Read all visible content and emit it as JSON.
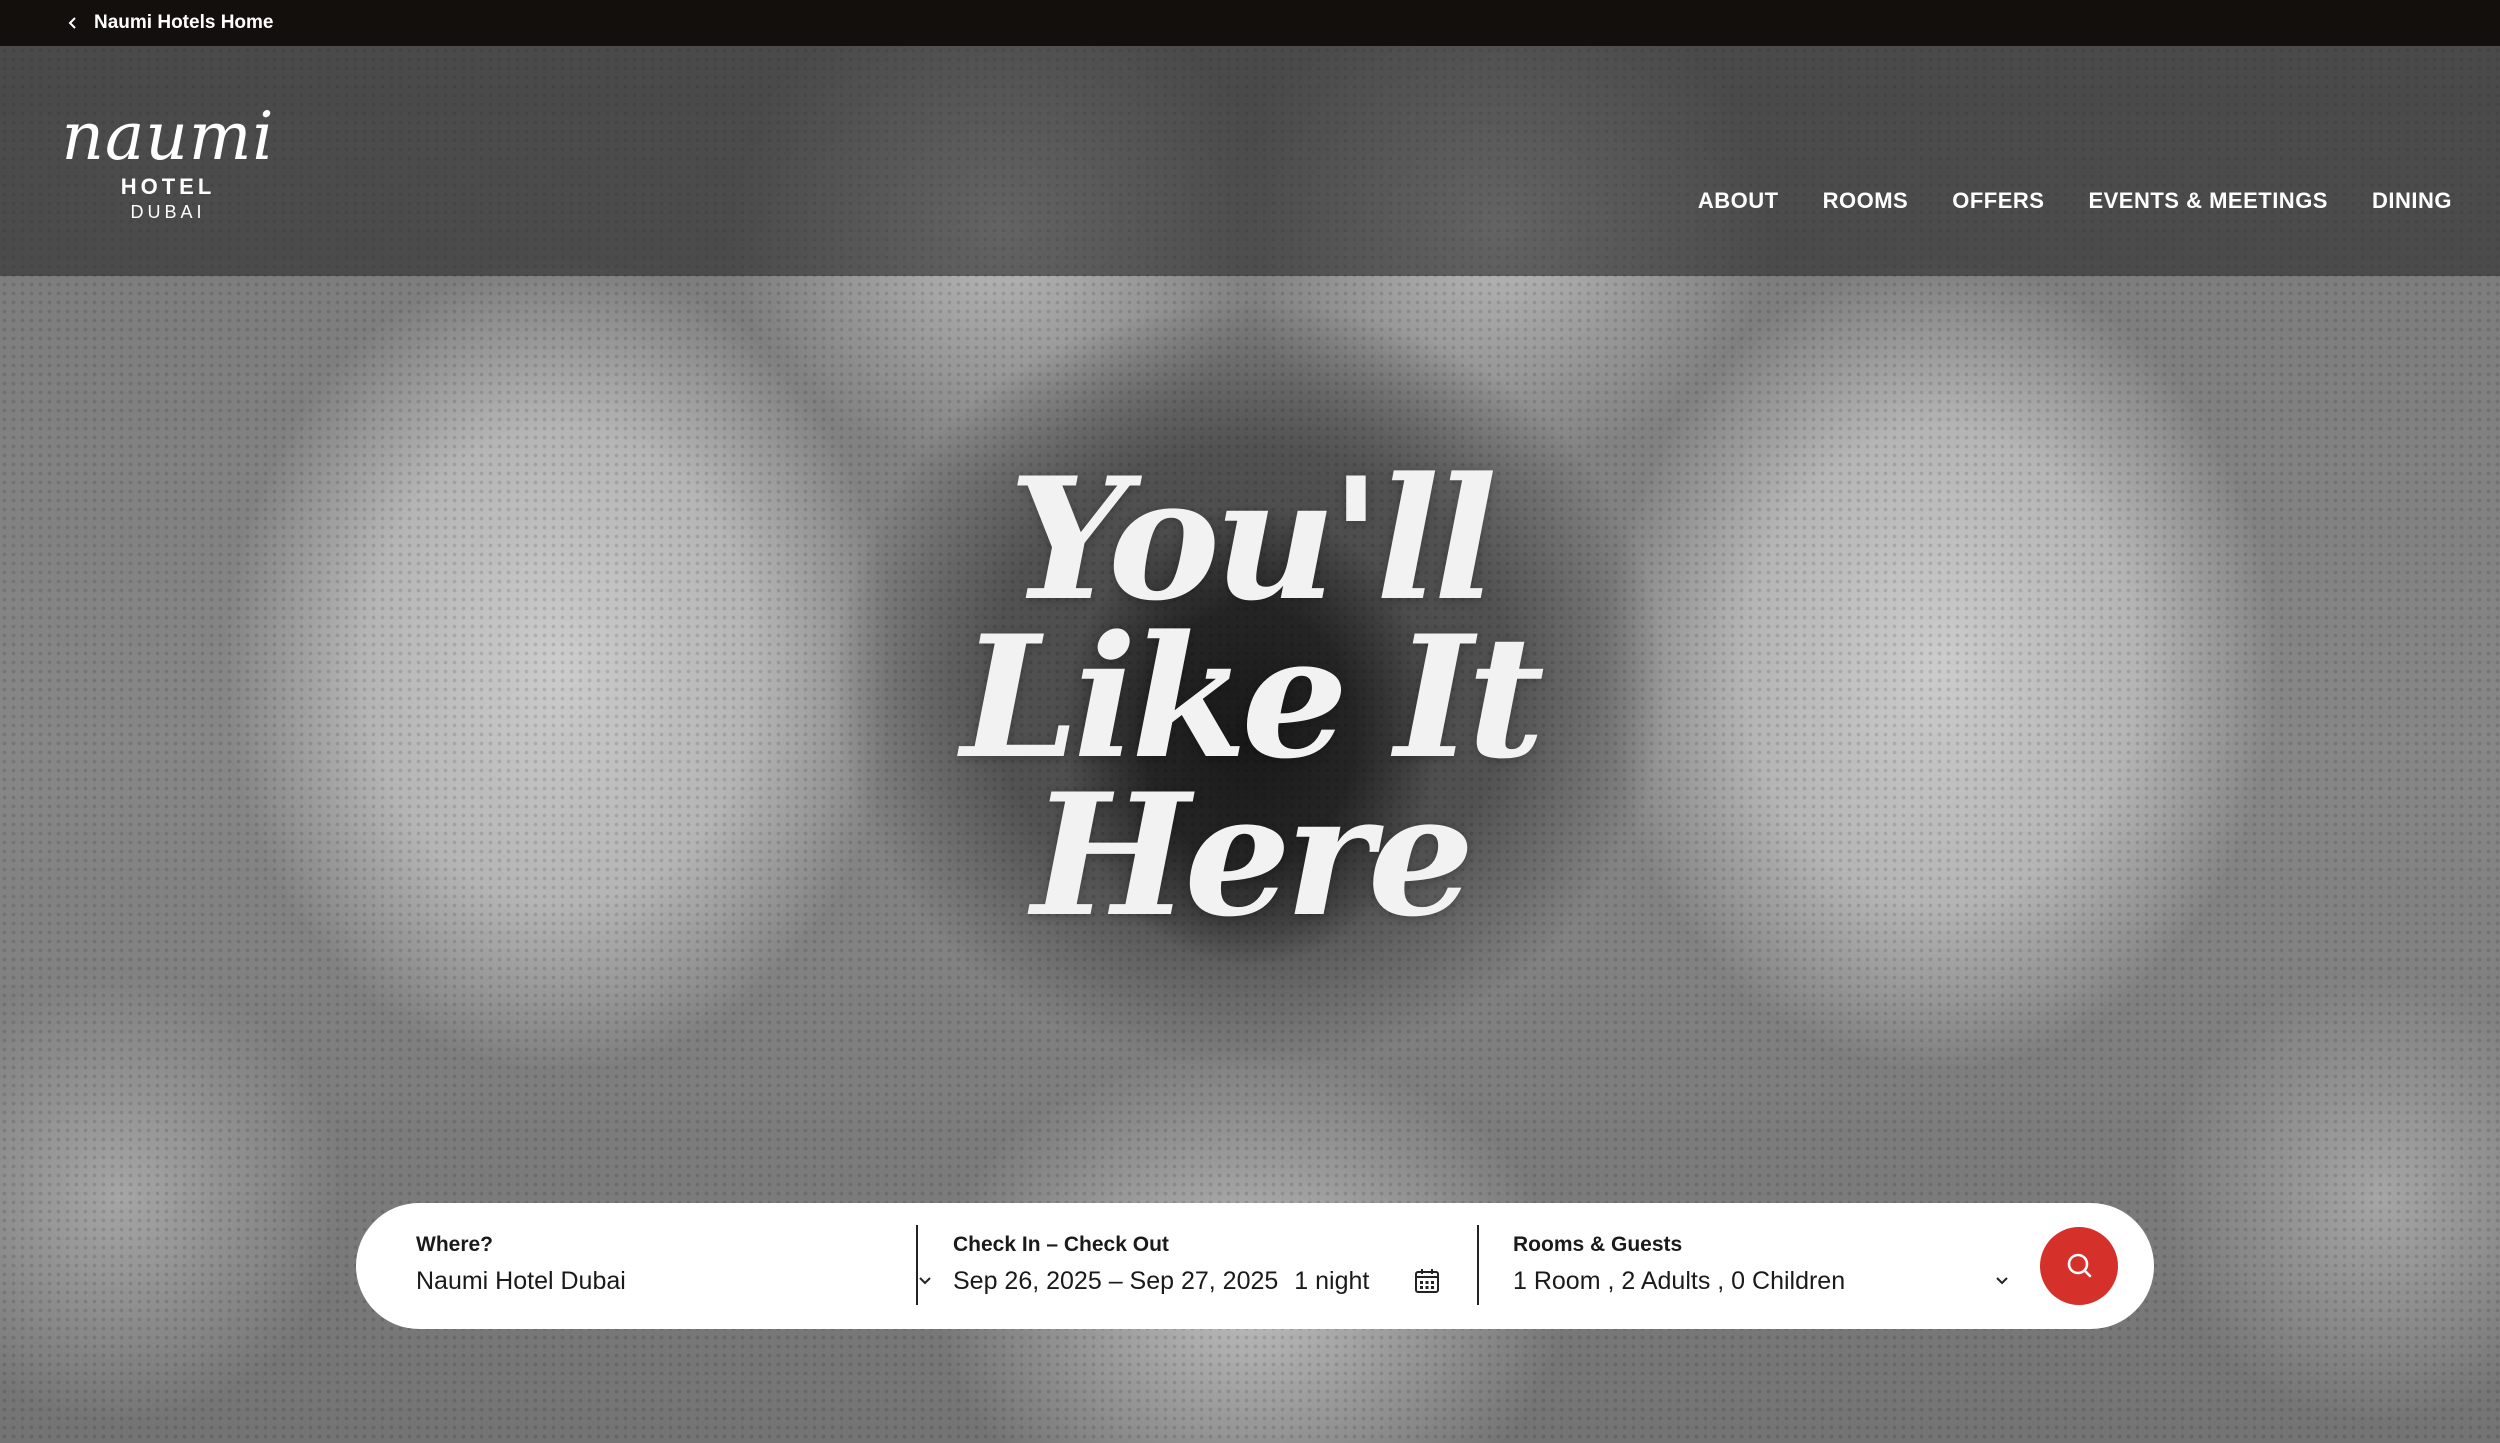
{
  "topbar": {
    "back_label": "Naumi Hotels Home"
  },
  "logo": {
    "script": "naumi",
    "line1": "HOTEL",
    "line2": "DUBAI"
  },
  "nav": {
    "items": [
      {
        "label": "ABOUT"
      },
      {
        "label": "ROOMS"
      },
      {
        "label": "OFFERS"
      },
      {
        "label": "EVENTS & MEETINGS"
      },
      {
        "label": "DINING"
      }
    ]
  },
  "hero": {
    "headline_lines": [
      "You'll",
      "Like It",
      "Here"
    ]
  },
  "booking": {
    "where_label": "Where?",
    "where_value": "Naumi Hotel Dubai",
    "dates_label": "Check In – Check Out",
    "dates_value": "Sep 26, 2025 – Sep 27, 2025",
    "nights_value": "1 night",
    "guests_label": "Rooms & Guests",
    "guests_value": "1 Room , 2 Adults , 0 Children"
  },
  "icons": {
    "back": "chevron-left-icon",
    "where_caret": "chevron-down-icon",
    "calendar": "calendar-icon",
    "guests_caret": "chevron-down-icon",
    "search": "search-icon"
  },
  "colors": {
    "topbar": "#120f0d",
    "search_button": "#d5302a"
  }
}
